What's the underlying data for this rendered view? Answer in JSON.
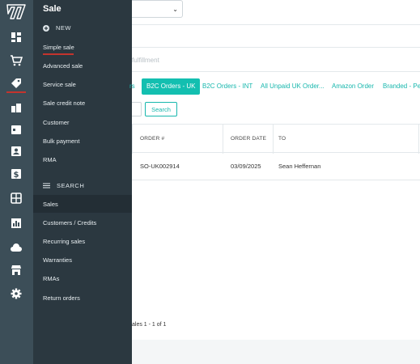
{
  "menu": {
    "title": "Sale",
    "new_section": "NEW",
    "new_items": [
      "Simple sale",
      "Advanced sale",
      "Service sale",
      "Sale credit note",
      "Customer",
      "Bulk payment",
      "RMA"
    ],
    "search_section": "SEARCH",
    "search_items": [
      "Sales",
      "Customers / Credits",
      "Recurring sales",
      "Warranties",
      "RMAs",
      "Return orders"
    ]
  },
  "main": {
    "faded_label": "fulfillment",
    "tabs": [
      "rs",
      "B2C Orders - UK",
      "B2C Orders - INT",
      "All Unpaid UK Order...",
      "Amazon Order",
      "Branded - Pe"
    ],
    "search_button": "Search",
    "columns": [
      "ORDER #",
      "ORDER DATE",
      "TO"
    ],
    "rows": [
      {
        "order": "SO-UK002914",
        "date": "03/09/2025",
        "to": "Sean Heffernan"
      }
    ],
    "pager": "ales 1 - 1 of 1"
  },
  "colors": {
    "rail": "#3c4e58",
    "menu": "#2b3840",
    "accent": "#13bfb0",
    "active_marker": "#c4342d"
  }
}
